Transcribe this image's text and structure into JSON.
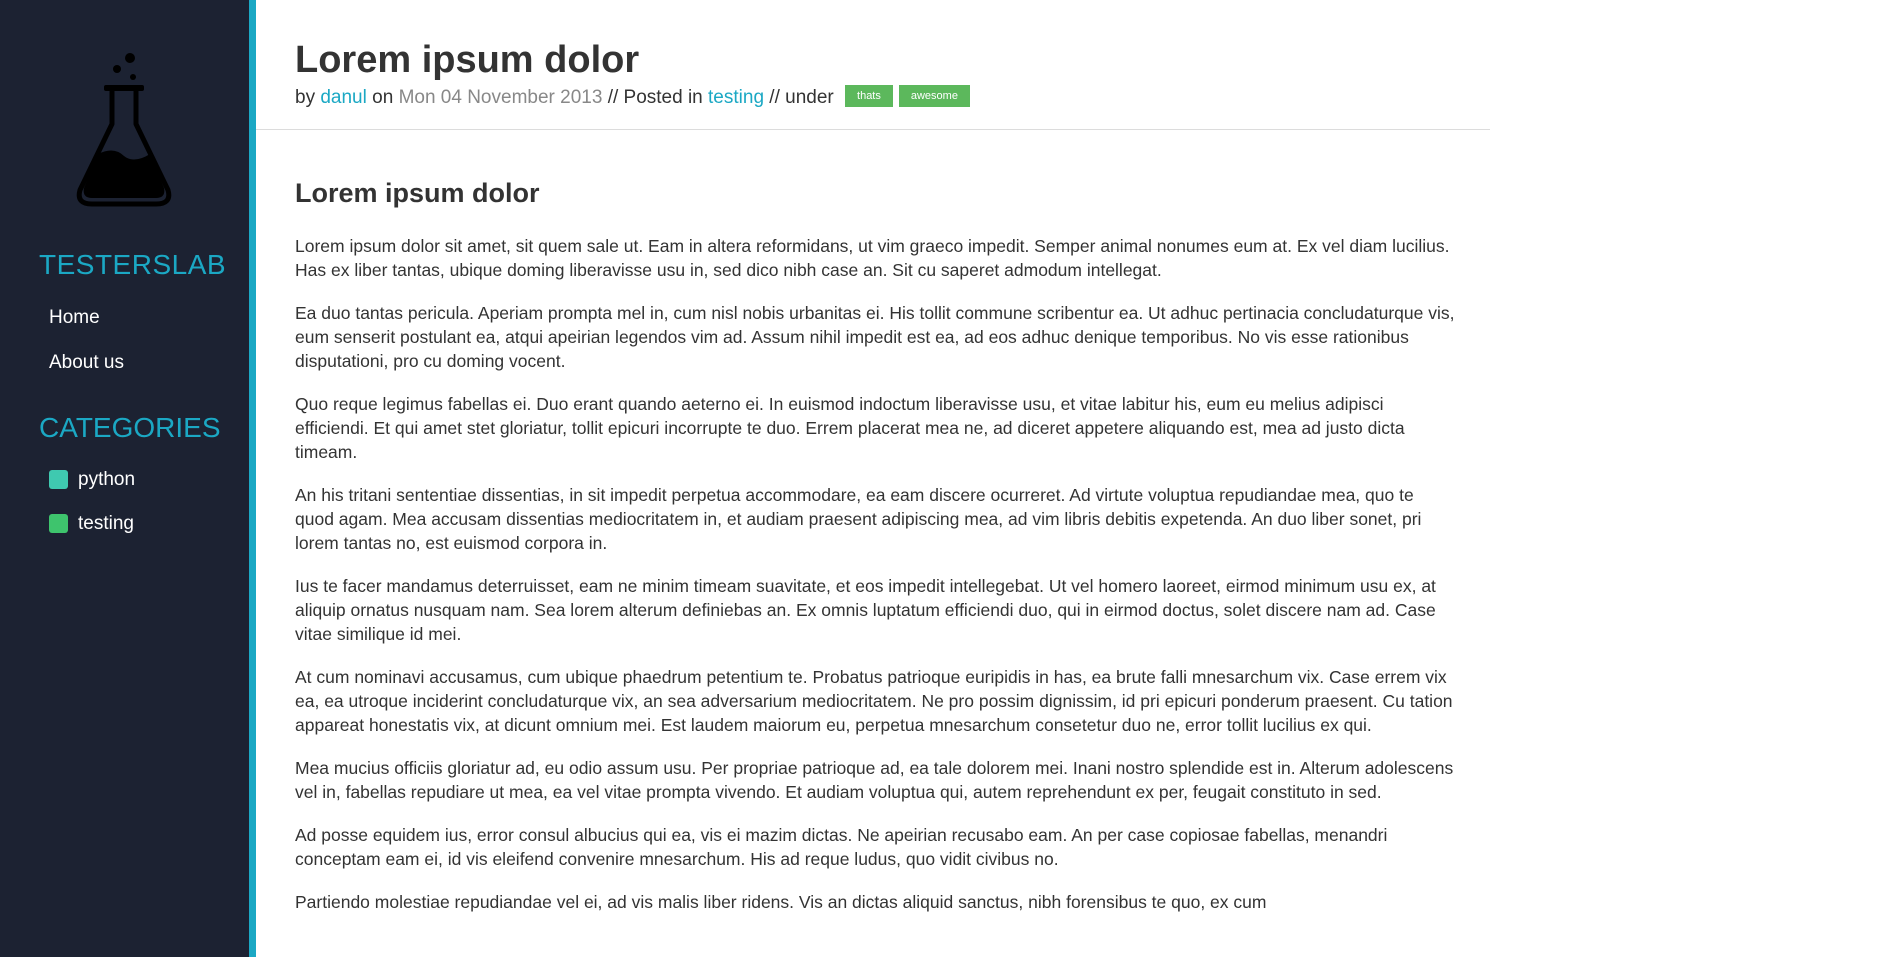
{
  "sidebar": {
    "brand": "TESTERSLAB",
    "nav": [
      {
        "label": "Home"
      },
      {
        "label": "About us"
      }
    ],
    "categories_heading": "CATEGORIES",
    "categories": [
      {
        "label": "python",
        "color": "#3fc9b0"
      },
      {
        "label": "testing",
        "color": "#3ec46d"
      }
    ],
    "logo_icon": "flask-icon"
  },
  "post": {
    "title": "Lorem ipsum dolor",
    "meta": {
      "by": "by",
      "author": "danul",
      "on": "on",
      "date": "Mon 04 November 2013",
      "posted_in": "// Posted in",
      "category": "testing",
      "under": "// under",
      "tags": [
        "thats",
        "awesome"
      ]
    },
    "heading": "Lorem ipsum dolor",
    "paragraphs": [
      "Lorem ipsum dolor sit amet, sit quem sale ut. Eam in altera reformidans, ut vim graeco impedit. Semper animal nonumes eum at. Ex vel diam lucilius. Has ex liber tantas, ubique doming liberavisse usu in, sed dico nibh case an. Sit cu saperet admodum intellegat.",
      "Ea duo tantas pericula. Aperiam prompta mel in, cum nisl nobis urbanitas ei. His tollit commune scribentur ea. Ut adhuc pertinacia concludaturque vis, eum senserit postulant ea, atqui apeirian legendos vim ad. Assum nihil impedit est ea, ad eos adhuc denique temporibus. No vis esse rationibus disputationi, pro cu doming vocent.",
      "Quo reque legimus fabellas ei. Duo erant quando aeterno ei. In euismod indoctum liberavisse usu, et vitae labitur his, eum eu melius adipisci efficiendi. Et qui amet stet gloriatur, tollit epicuri incorrupte te duo. Errem placerat mea ne, ad diceret appetere aliquando est, mea ad justo dicta timeam.",
      "An his tritani sententiae dissentias, in sit impedit perpetua accommodare, ea eam discere ocurreret. Ad virtute voluptua repudiandae mea, quo te quod agam. Mea accusam dissentias mediocritatem in, et audiam praesent adipiscing mea, ad vim libris debitis expetenda. An duo liber sonet, pri lorem tantas no, est euismod corpora in.",
      "Ius te facer mandamus deterruisset, eam ne minim timeam suavitate, et eos impedit intellegebat. Ut vel homero laoreet, eirmod minimum usu ex, at aliquip ornatus nusquam nam. Sea lorem alterum definiebas an. Ex omnis luptatum efficiendi duo, qui in eirmod doctus, solet discere nam ad. Case vitae similique id mei.",
      "At cum nominavi accusamus, cum ubique phaedrum petentium te. Probatus patrioque euripidis in has, ea brute falli mnesarchum vix. Case errem vix ea, ea utroque inciderint concludaturque vix, an sea adversarium mediocritatem. Ne pro possim dignissim, id pri epicuri ponderum praesent. Cu tation appareat honestatis vix, at dicunt omnium mei. Est laudem maiorum eu, perpetua mnesarchum consetetur duo ne, error tollit lucilius ex qui.",
      "Mea mucius officiis gloriatur ad, eu odio assum usu. Per propriae patrioque ad, ea tale dolorem mei. Inani nostro splendide est in. Alterum adolescens vel in, fabellas repudiare ut mea, ea vel vitae prompta vivendo. Et audiam voluptua qui, autem reprehendunt ex per, feugait constituto in sed.",
      "Ad posse equidem ius, error consul albucius qui ea, vis ei mazim dictas. Ne apeirian recusabo eam. An per case copiosae fabellas, menandri conceptam eam ei, id vis eleifend convenire mnesarchum. His ad reque ludus, quo vidit civibus no.",
      "Partiendo molestiae repudiandae vel ei, ad vis malis liber ridens. Vis an dictas aliquid sanctus, nibh forensibus te quo, ex cum"
    ]
  },
  "colors": {
    "sidebar_bg": "#1c2232",
    "accent": "#1ba8c4",
    "tag_bg": "#5cb85c"
  }
}
